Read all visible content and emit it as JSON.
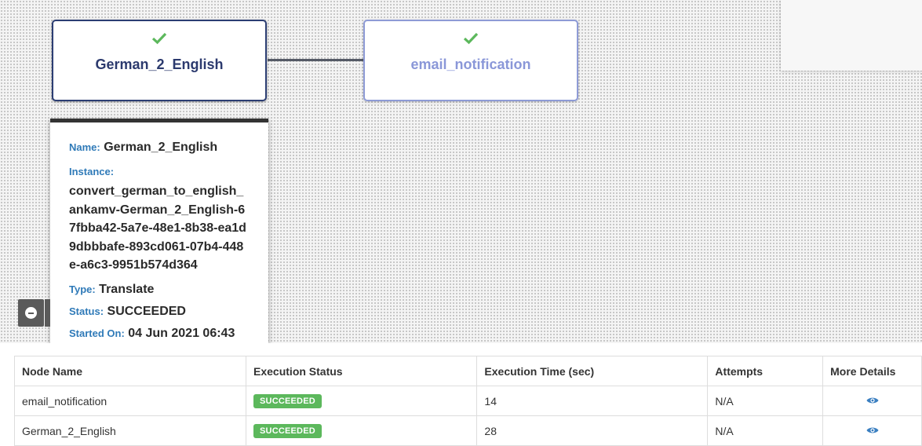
{
  "graph": {
    "nodes": [
      {
        "label": "German_2_English",
        "status_icon": "check-icon"
      },
      {
        "label": "email_notification",
        "status_icon": "check-icon"
      }
    ]
  },
  "info_card": {
    "name_key": "Name:",
    "name_value": "German_2_English",
    "instance_key": "Instance:",
    "instance_value": "convert_german_to_english_ankamv-German_2_English-67fbba42-5a7e-48e1-8b38-ea1d9dbbbafe-893cd061-07b4-448e-a6c3-9951b574d364",
    "type_key": "Type:",
    "type_value": "Translate",
    "status_key": "Status:",
    "status_value": "SUCCEEDED",
    "started_key": "Started On:",
    "started_value": "04 Jun 2021 06:43"
  },
  "table": {
    "headers": [
      "Node Name",
      "Execution Status",
      "Execution Time (sec)",
      "Attempts",
      "More Details"
    ],
    "rows": [
      {
        "node": "email_notification",
        "status": "SUCCEEDED",
        "time": "14",
        "attempts": "N/A"
      },
      {
        "node": "German_2_English",
        "status": "SUCCEEDED",
        "time": "28",
        "attempts": "N/A"
      }
    ]
  },
  "colors": {
    "success": "#5cb85c",
    "accent": "#2f7ab8"
  }
}
